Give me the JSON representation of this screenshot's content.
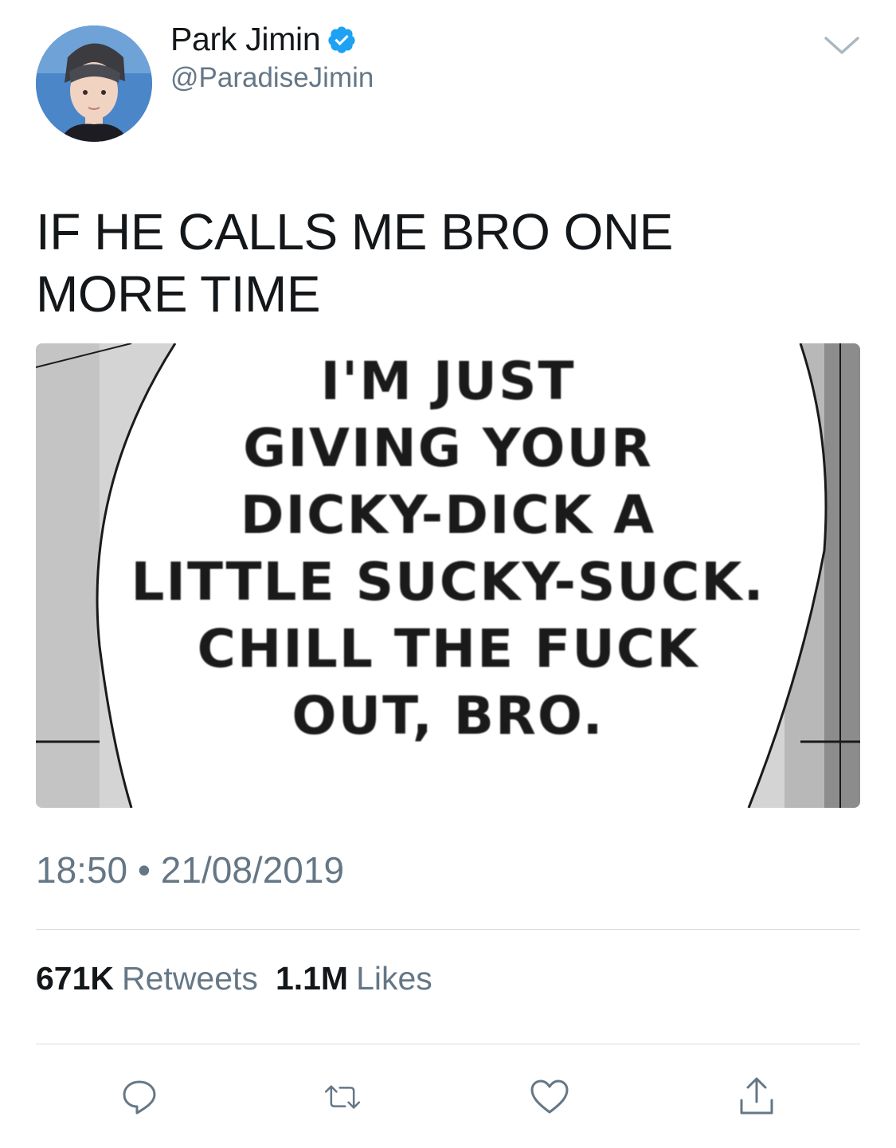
{
  "author": {
    "name": "Park Jimin",
    "handle": "@ParadiseJimin",
    "verified_icon": "verified-badge-icon"
  },
  "tweet": {
    "text": "IF HE CALLS ME BRO ONE MORE TIME",
    "media": {
      "lines": [
        "I'M JUST",
        "GIVING YOUR",
        "DICKY-DICK A",
        "LITTLE SUCKY-SUCK.",
        "CHILL THE FUCK",
        "OUT, BRO."
      ]
    },
    "time": "18:50",
    "separator": "•",
    "date": "21/08/2019"
  },
  "stats": {
    "retweets_count": "671K",
    "retweets_label": "Retweets",
    "likes_count": "1.1M",
    "likes_label": "Likes"
  },
  "actions": [
    {
      "icon": "reply-icon"
    },
    {
      "icon": "retweet-icon"
    },
    {
      "icon": "like-icon"
    },
    {
      "icon": "share-icon"
    }
  ],
  "colors": {
    "text": "#14171a",
    "secondary": "#657786",
    "verified": "#1da1f2",
    "divider": "#d6dbe0"
  }
}
